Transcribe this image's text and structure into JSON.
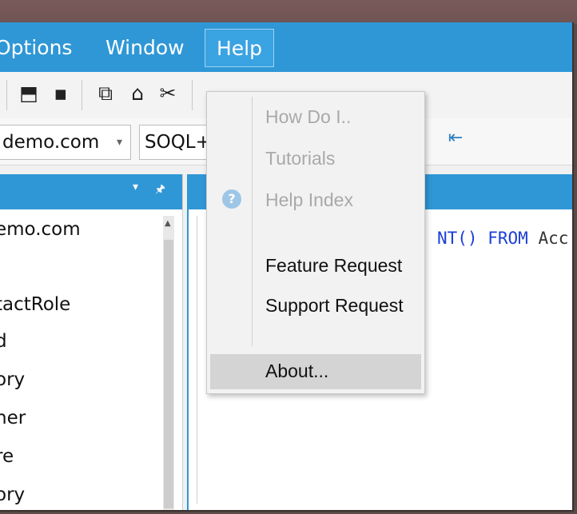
{
  "menubar": {
    "items": [
      {
        "label": "Options"
      },
      {
        "label": "Window"
      },
      {
        "label": "Help"
      }
    ]
  },
  "toolbar": {
    "icons": [
      "refresh-icon",
      "save-icon",
      "copy-icon",
      "paste-icon",
      "cut-icon"
    ],
    "glyphs": [
      "⬒",
      "▪",
      "⧉",
      "⌂",
      "✂"
    ],
    "right_icon_glyph": "⇤"
  },
  "toolbar2": {
    "connection_combo": "demo.com",
    "query_combo": "SOQL+"
  },
  "left_panel": {
    "header_controls": [
      "▾",
      "🖈"
    ],
    "tree_items": [
      "emo.com",
      "tactRole",
      "d",
      "ory",
      "ner",
      "re",
      "ory"
    ]
  },
  "editor": {
    "code_keyword1": "NT()",
    "code_keyword2": "FROM",
    "code_rest": "Acc"
  },
  "help_menu": {
    "items": [
      {
        "label": "How Do I..",
        "enabled": false
      },
      {
        "label": "Tutorials",
        "enabled": false
      },
      {
        "label": "Help Index",
        "enabled": false
      },
      {
        "label": "Feature Request",
        "enabled": true
      },
      {
        "label": "Support Request",
        "enabled": true
      },
      {
        "label": "About...",
        "enabled": true,
        "highlighted": true
      }
    ],
    "help_icon_glyph": "?"
  },
  "colors": {
    "accent": "#2f97d6",
    "disabled_text": "#a9a9a9",
    "highlight": "#d4d4d4"
  }
}
